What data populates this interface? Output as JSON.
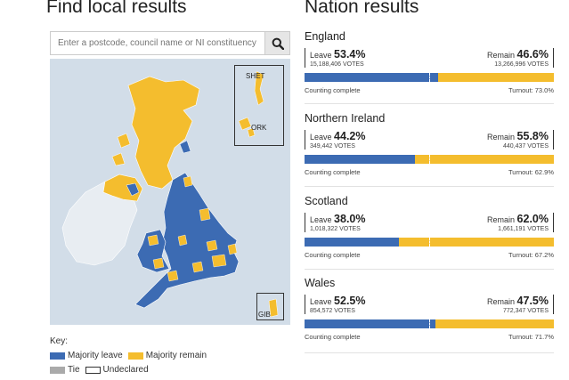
{
  "left_title": "Find local results",
  "right_title": "Nation results",
  "search": {
    "placeholder": "Enter a postcode, council name or NI constituency",
    "button_icon": "search-icon"
  },
  "map": {
    "inset_shetland": "SHET",
    "inset_orkney": "ORK",
    "inset_gibraltar": "GIB"
  },
  "key": {
    "title": "Key:",
    "leave": "Majority leave",
    "remain": "Majority remain",
    "tie": "Tie",
    "undeclared": "Undeclared"
  },
  "colors": {
    "leave": "#3c6bb3",
    "remain": "#f4bd2e",
    "tie": "#aaaaaa",
    "sea": "#d2dde8",
    "ireland": "#e8edf2"
  },
  "nations": [
    {
      "name": "England",
      "leave_label": "Leave",
      "leave_pct": "53.4%",
      "leave_votes": "15,188,406 VOTES",
      "remain_label": "Remain",
      "remain_pct": "46.6%",
      "remain_votes": "13,266,996 VOTES",
      "leave_share": 53.4,
      "status": "Counting complete",
      "turnout": "Turnout: 73.0%"
    },
    {
      "name": "Northern Ireland",
      "leave_label": "Leave",
      "leave_pct": "44.2%",
      "leave_votes": "349,442 VOTES",
      "remain_label": "Remain",
      "remain_pct": "55.8%",
      "remain_votes": "440,437 VOTES",
      "leave_share": 44.2,
      "status": "Counting complete",
      "turnout": "Turnout: 62.9%"
    },
    {
      "name": "Scotland",
      "leave_label": "Leave",
      "leave_pct": "38.0%",
      "leave_votes": "1,018,322 VOTES",
      "remain_label": "Remain",
      "remain_pct": "62.0%",
      "remain_votes": "1,661,191 VOTES",
      "leave_share": 38.0,
      "status": "Counting complete",
      "turnout": "Turnout: 67.2%"
    },
    {
      "name": "Wales",
      "leave_label": "Leave",
      "leave_pct": "52.5%",
      "leave_votes": "854,572 VOTES",
      "remain_label": "Remain",
      "remain_pct": "47.5%",
      "remain_votes": "772,347 VOTES",
      "leave_share": 52.5,
      "status": "Counting complete",
      "turnout": "Turnout: 71.7%"
    }
  ]
}
